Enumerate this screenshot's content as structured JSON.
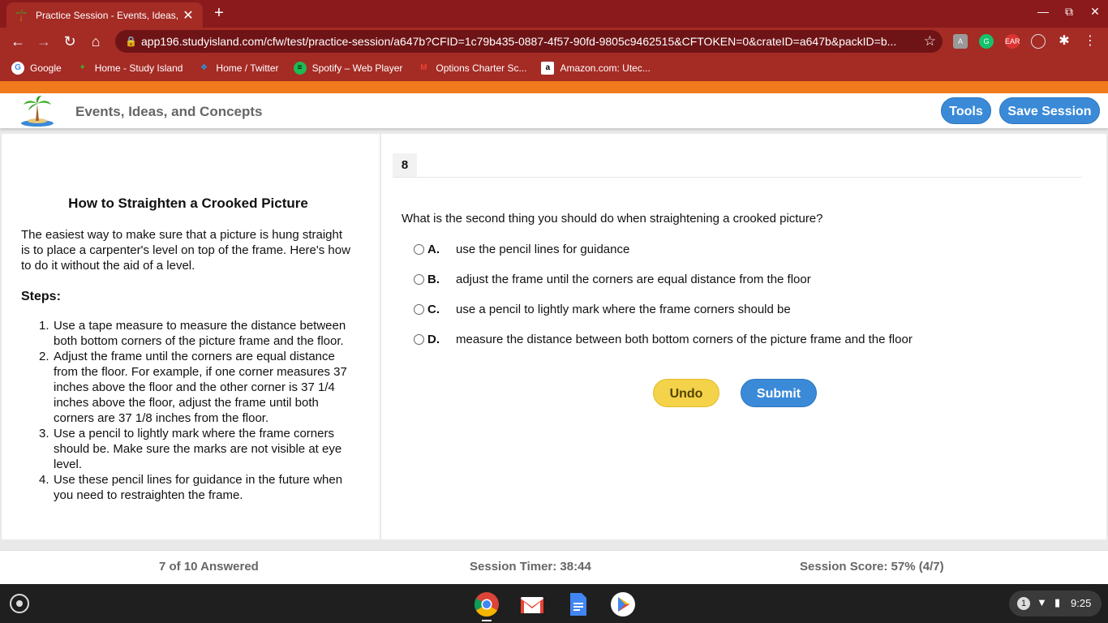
{
  "browser": {
    "tab_title": "Practice Session - Events, Ideas,",
    "tab_close": "✕",
    "new_tab": "+",
    "url": "app196.studyisland.com/cfw/test/practice-session/a647b?CFID=1c79b435-0887-4f57-90fd-9805c9462515&CFTOKEN=0&crateID=a647b&packID=b...",
    "bookmarks": [
      {
        "label": "Google",
        "icon": "google-icon"
      },
      {
        "label": "Home - Study Island",
        "icon": "palm-tree-icon"
      },
      {
        "label": "Home / Twitter",
        "icon": "twitter-icon"
      },
      {
        "label": "Spotify – Web Player",
        "icon": "spotify-icon"
      },
      {
        "label": "Options Charter Sc...",
        "icon": "gmail-icon"
      },
      {
        "label": "Amazon.com: Utec...",
        "icon": "amazon-icon"
      }
    ]
  },
  "header": {
    "title": "Events, Ideas, and Concepts",
    "tools_label": "Tools",
    "save_label": "Save Session"
  },
  "passage": {
    "title": "How to Straighten a Crooked Picture",
    "intro": "The easiest way to make sure that a picture is hung straight is to place a carpenter's level on top of the frame. Here's how to do it without the aid of a level.",
    "steps_label": "Steps:",
    "steps": [
      {
        "num": "1.",
        "text": "Use a tape measure to measure the distance between both bottom corners of the picture frame and the floor."
      },
      {
        "num": "2.",
        "text": "Adjust the frame until the corners are equal distance from the floor. For example, if one corner measures 37 inches above the floor and the other corner is 37 1/4 inches above the floor, adjust the frame until both corners are 37 1/8 inches from the floor."
      },
      {
        "num": "3.",
        "text": "Use a pencil to lightly mark where the frame corners should be. Make sure the marks are not visible at eye level."
      },
      {
        "num": "4.",
        "text": "Use these pencil lines for guidance in the future when you need to restraighten the frame."
      }
    ]
  },
  "question": {
    "number": "8",
    "text": "What is the second thing you should do when straightening a crooked picture?",
    "choices": [
      {
        "letter": "A.",
        "text": "use the pencil lines for guidance"
      },
      {
        "letter": "B.",
        "text": "adjust the frame until the corners are equal distance from the floor"
      },
      {
        "letter": "C.",
        "text": "use a pencil to lightly mark where the frame corners should be"
      },
      {
        "letter": "D.",
        "text": "measure the distance between both bottom corners of the picture frame and the floor"
      }
    ],
    "undo_label": "Undo",
    "submit_label": "Submit"
  },
  "status": {
    "answered": "7 of 10 Answered",
    "timer": "Session Timer: 38:44",
    "score": "Session Score: 57% (4/7)"
  },
  "shelf": {
    "apps": [
      "chrome-icon",
      "gmail-icon",
      "docs-icon",
      "play-store-icon"
    ],
    "notification_count": "1",
    "time": "9:25"
  },
  "colors": {
    "chrome_frame": "#8a1a1b",
    "accent_orange": "#f07a1c",
    "button_blue": "#3a8ad8",
    "button_yellow": "#f4d24a"
  }
}
